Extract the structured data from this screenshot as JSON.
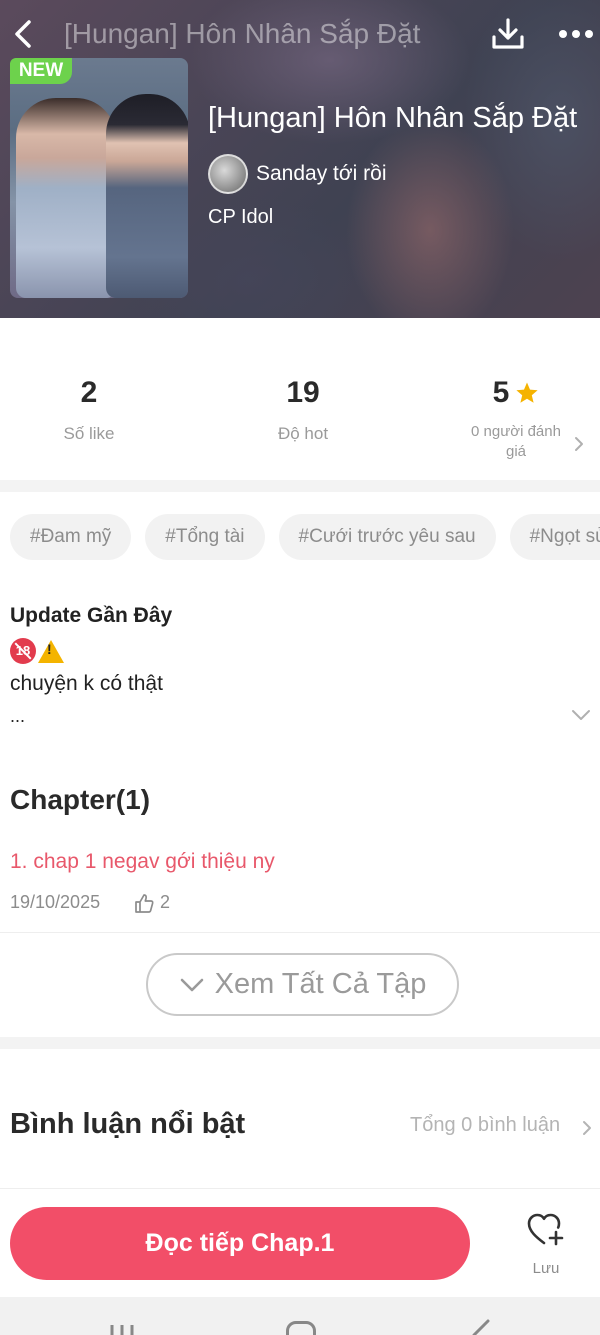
{
  "topbar": {
    "title": "[Hungan] Hôn Nhân Sắp Đặt"
  },
  "story": {
    "badge": "NEW",
    "title": "[Hungan] Hôn Nhân Sắp Đặt",
    "author": "Sanday tới rồi",
    "category": "CP Idol"
  },
  "stats": {
    "likes_value": "2",
    "likes_label": "Số like",
    "hot_value": "19",
    "hot_label": "Độ hot",
    "rating_value": "5",
    "rating_label_line1": "0 người đánh",
    "rating_label_line2": "giá"
  },
  "tags": [
    "#Đam mỹ",
    "#Tổng tài",
    "#Cưới trước yêu sau",
    "#Ngọt sủng"
  ],
  "update": {
    "title": "Update Gần Đây",
    "age_badge": "18",
    "warning_mark": "!",
    "text": "chuyện k có thật",
    "ellipsis": "..."
  },
  "chapters": {
    "heading": "Chapter(1)",
    "items": [
      {
        "name": "1. chap 1 negav gới thiệu ny",
        "date": "19/10/2025",
        "likes": "2"
      }
    ],
    "view_all_label": "Xem Tất Cả Tập"
  },
  "comments": {
    "title": "Bình luận nổi bật",
    "total": "Tổng 0 bình luận"
  },
  "actions": {
    "read_label": "Đọc tiếp Chap.1",
    "save_label": "Lưu"
  },
  "colors": {
    "accent": "#f24e68",
    "chapter_link": "#e8586b",
    "new_badge": "#6dd24c",
    "star": "#f5b301"
  },
  "icons": {
    "back": "chevron-left-icon",
    "download": "download-icon",
    "more": "more-horizontal-icon",
    "star": "star-icon",
    "thumb": "thumbs-up-icon",
    "save": "heart-plus-icon"
  }
}
